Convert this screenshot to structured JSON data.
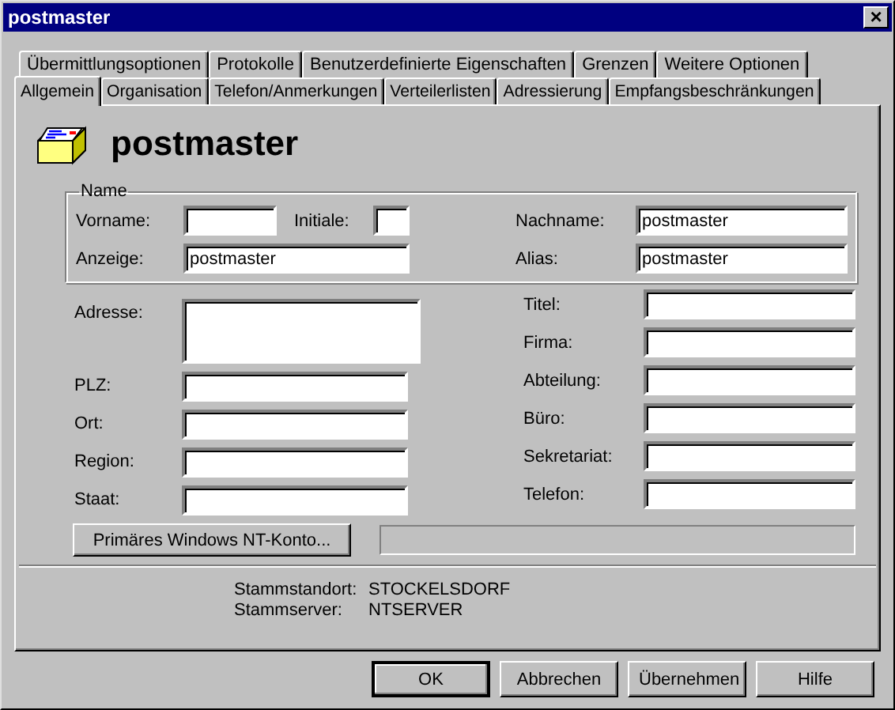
{
  "window": {
    "title": "postmaster",
    "close": "×"
  },
  "tab_rows": [
    [
      {
        "label": "Übermittlungsoptionen",
        "selected": false
      },
      {
        "label": "Protokolle",
        "selected": false
      },
      {
        "label": "Benutzerdefinierte Eigenschaften",
        "selected": false
      },
      {
        "label": "Grenzen",
        "selected": false
      },
      {
        "label": "Weitere Optionen",
        "selected": false
      }
    ],
    [
      {
        "label": "Allgemein",
        "selected": true
      },
      {
        "label": "Organisation",
        "selected": false
      },
      {
        "label": "Telefon/Anmerkungen",
        "selected": false
      },
      {
        "label": "Verteilerlisten",
        "selected": false
      },
      {
        "label": "Adressierung",
        "selected": false
      },
      {
        "label": "Empfangsbeschränkungen",
        "selected": false
      }
    ]
  ],
  "heading": "postmaster",
  "name_group": {
    "legend": "Name",
    "left": [
      {
        "label": "Vorname:",
        "kind": "short"
      },
      {
        "label": "Initiale:",
        "kind": "tiny"
      },
      {
        "label": "Anzeige:",
        "kind": "wide",
        "value": "postmaster"
      }
    ],
    "right": [
      {
        "label": "Nachname:",
        "kind": "wide",
        "value": "postmaster"
      },
      {
        "label": "Alias:",
        "kind": "wide",
        "value": "postmaster"
      }
    ]
  },
  "address": {
    "left": [
      {
        "label": "Adresse:",
        "kind": "multiline"
      },
      {
        "label": "PLZ:",
        "kind": "wide"
      },
      {
        "label": "Ort:",
        "kind": "wide"
      },
      {
        "label": "Region:",
        "kind": "wide"
      },
      {
        "label": "Staat:",
        "kind": "wide"
      }
    ],
    "right": [
      {
        "label": "Titel:",
        "kind": "wide"
      },
      {
        "label": "Firma:",
        "kind": "wide"
      },
      {
        "label": "Abteilung:",
        "kind": "wide"
      },
      {
        "label": "Büro:",
        "kind": "wide"
      },
      {
        "label": "Sekretariat:",
        "kind": "wide"
      },
      {
        "label": "Telefon:",
        "kind": "wide"
      }
    ]
  },
  "account": {
    "button": "Primäres Windows NT-Konto...",
    "field_disabled": true
  },
  "info": [
    {
      "label": "Stammstandort:",
      "value": "STOCKELSDORF"
    },
    {
      "label": "Stammserver:",
      "value": "NTSERVER"
    }
  ],
  "buttons": [
    {
      "label": "OK",
      "default": true
    },
    {
      "label": "Abbrechen",
      "default": false
    },
    {
      "label": "Übernehmen",
      "default": false
    },
    {
      "label": "Hilfe",
      "default": false
    }
  ]
}
